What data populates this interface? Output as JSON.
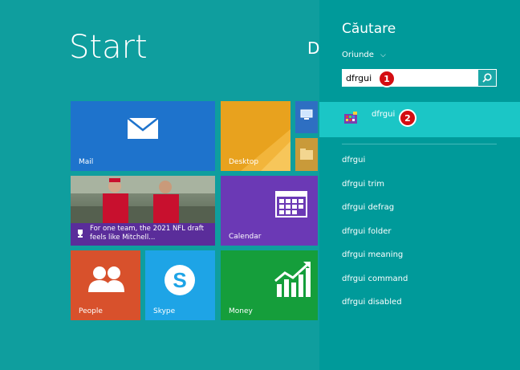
{
  "start": {
    "title": "Start",
    "user_initial": "D"
  },
  "tiles": {
    "mail": "Mail",
    "desktop": "Desktop",
    "news": "For one team, the 2021 NFL draft feels like Mitchell...",
    "calendar": "Calendar",
    "people": "People",
    "skype": "Skype",
    "money": "Money"
  },
  "search": {
    "title": "Căutare",
    "scope": "Oriunde",
    "query": "dfrgui",
    "top_result": "dfrgui",
    "suggestions": [
      "dfrgui",
      "dfrgui trim",
      "dfrgui defrag",
      "dfrgui folder",
      "dfrgui meaning",
      "dfrgui command",
      "dfrgui disabled"
    ]
  },
  "badges": {
    "one": "1",
    "two": "2"
  },
  "colors": {
    "background": "#0f9e9e",
    "panel": "#009a9a",
    "highlight": "#1bc6c6",
    "badge": "#d40d12"
  }
}
